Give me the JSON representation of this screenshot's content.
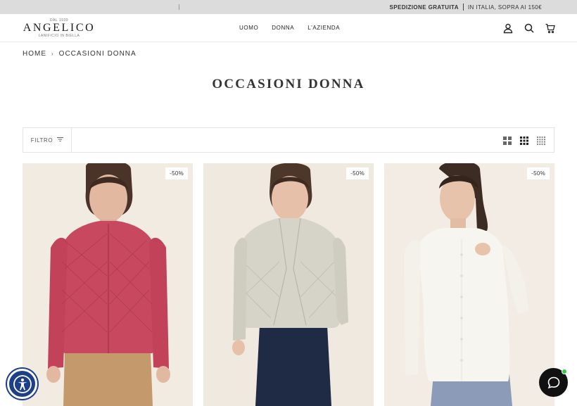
{
  "announcement": {
    "highlight": "SPEDIZIONE GRATUITA",
    "detail": "IN ITALIA, SOPRA AI 150€"
  },
  "logo": {
    "since": "DAL 1939",
    "name": "ANGELICO",
    "tagline": "LANIFICIO IN BIELLA"
  },
  "nav": {
    "items": [
      "UOMO",
      "DONNA",
      "L'AZIENDA"
    ]
  },
  "header_icons": [
    "account-icon",
    "search-icon",
    "cart-icon"
  ],
  "breadcrumb": {
    "home": "HOME",
    "current": "OCCASIONI DONNA"
  },
  "page": {
    "title": "OCCASIONI DONNA"
  },
  "toolbar": {
    "filter_label": "FILTRO",
    "grid_options": [
      "grid-large-icon",
      "grid-medium-icon",
      "grid-small-icon"
    ]
  },
  "products": [
    {
      "badge": "-50%",
      "garment_color": "#c8485f"
    },
    {
      "badge": "-50%",
      "garment_color": "#d6d3c8"
    },
    {
      "badge": "-50%",
      "garment_color": "#f7f5ef"
    }
  ],
  "colors": {
    "announcement_bg": "#dcdcdc",
    "accessibility_button": "#1d3f87",
    "chat_button": "#111111",
    "online_dot": "#2ecc40"
  }
}
